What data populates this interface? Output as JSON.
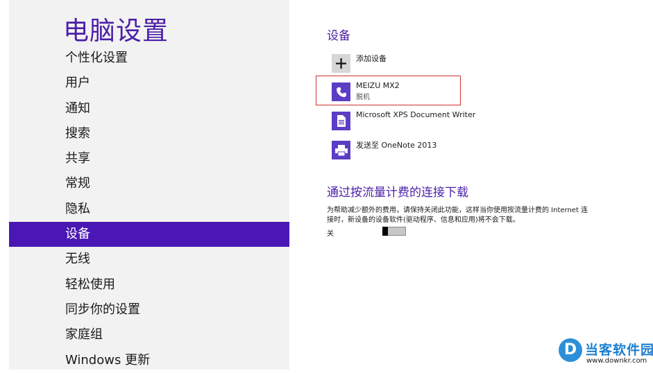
{
  "sidebar": {
    "title": "电脑设置",
    "items": [
      {
        "label": "个性化设置"
      },
      {
        "label": "用户"
      },
      {
        "label": "通知"
      },
      {
        "label": "搜索"
      },
      {
        "label": "共享"
      },
      {
        "label": "常规"
      },
      {
        "label": "隐私"
      },
      {
        "label": "设备",
        "selected": true
      },
      {
        "label": "无线"
      },
      {
        "label": "轻松使用"
      },
      {
        "label": "同步你的设置"
      },
      {
        "label": "家庭组"
      },
      {
        "label": "Windows 更新"
      }
    ]
  },
  "devices": {
    "title": "设备",
    "add_label": "添加设备",
    "list": [
      {
        "name": "MEIZU MX2",
        "status": "脱机",
        "icon": "phone-icon"
      },
      {
        "name": "Microsoft XPS Document Writer",
        "icon": "document-printer-icon"
      },
      {
        "name": "发送至 OneNote 2013",
        "icon": "printer-icon"
      }
    ]
  },
  "metered": {
    "title": "通过按流量计费的连接下载",
    "description": "为帮助减少额外的费用，请保持关闭此功能，这样当你使用按流量计费的 Internet 连接时，新设备的设备软件(驱动程序、信息和应用)将不会下载。",
    "toggle_label": "关",
    "toggle_on": false
  },
  "watermark": {
    "title": "当客软件园",
    "url": "www.downkr.com",
    "logo_letter": "D"
  },
  "colors": {
    "accent": "#4a17b4",
    "title": "#4c1fa8",
    "tile": "#5b3ec4",
    "sidebar_bg": "#f2f2f2",
    "highlight_border": "#cf3030"
  }
}
